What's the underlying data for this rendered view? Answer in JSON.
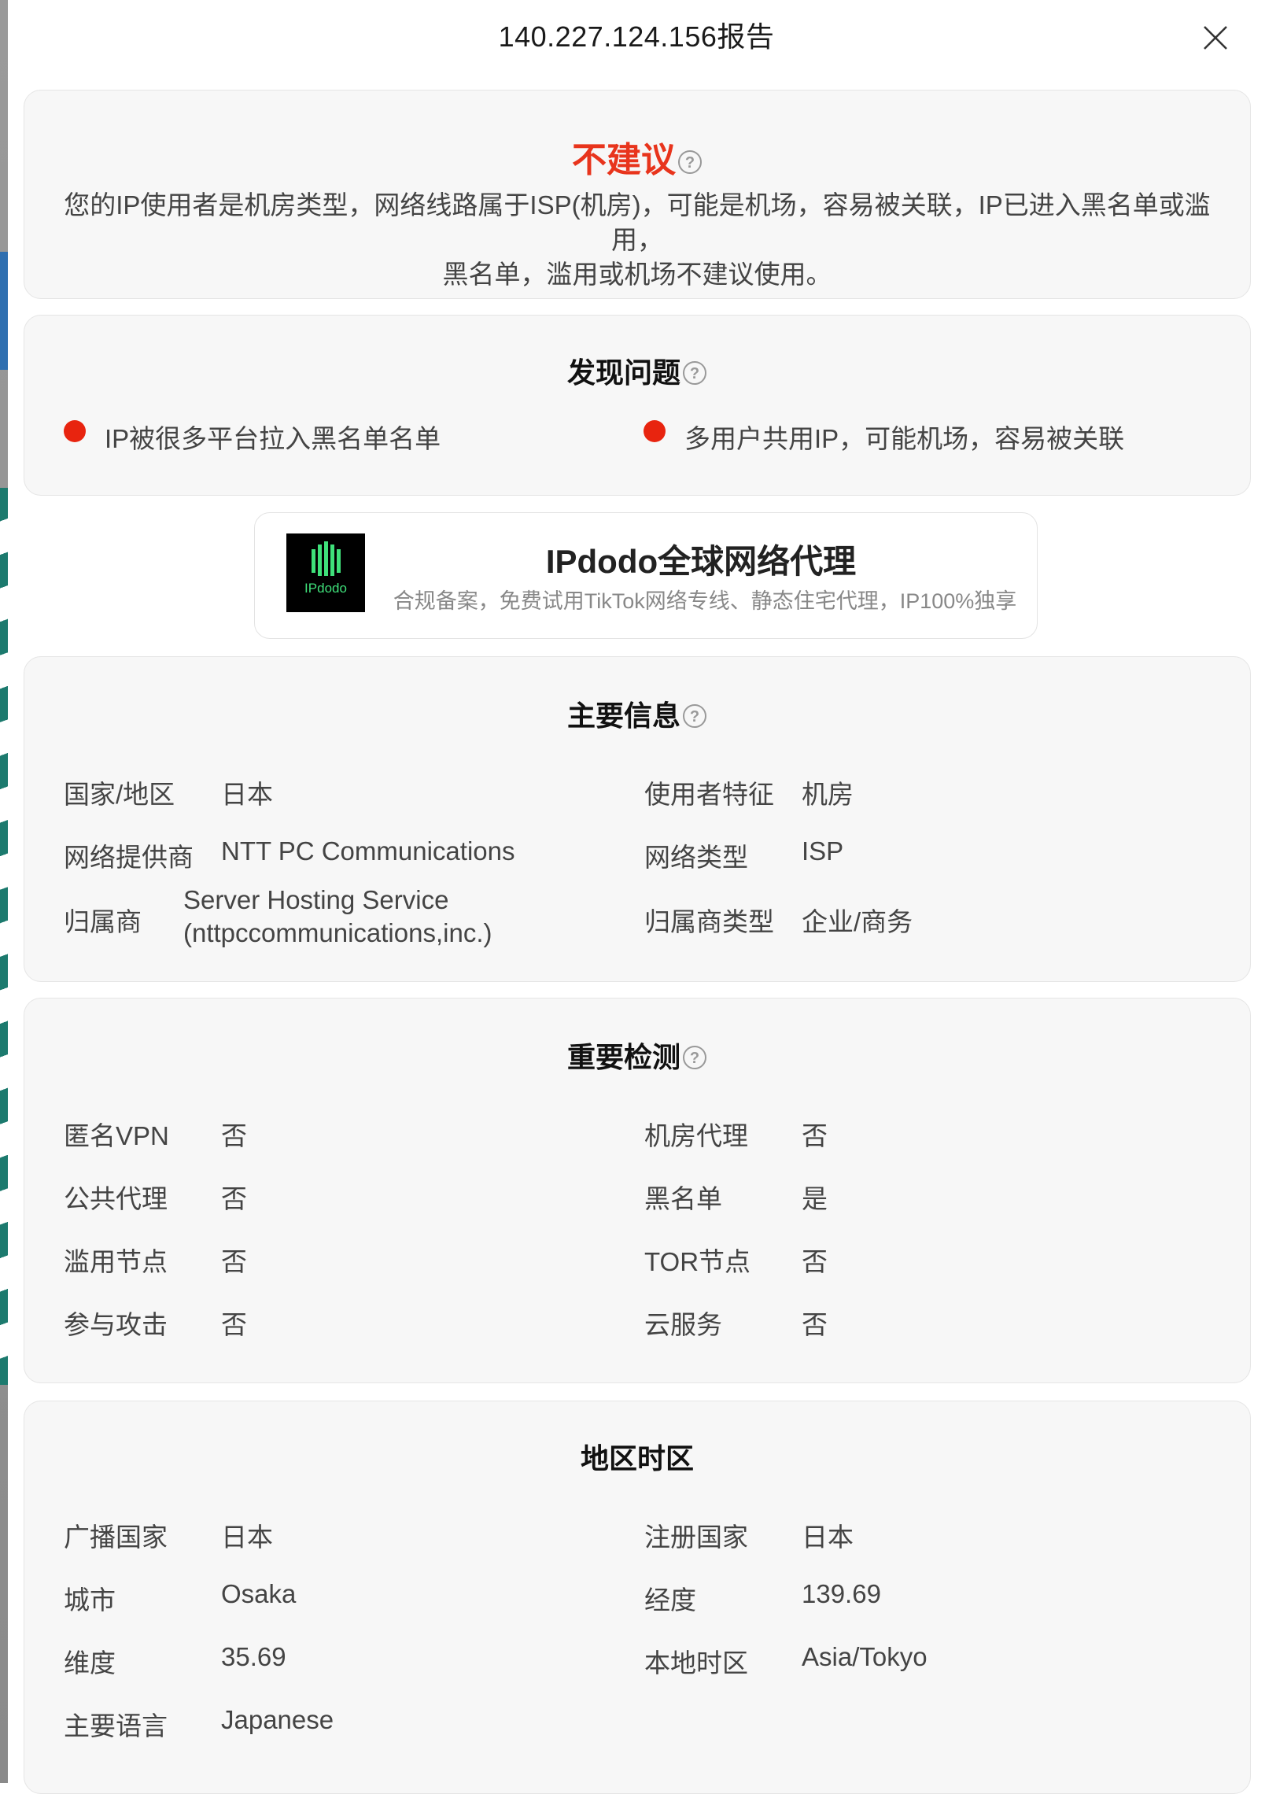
{
  "dialog": {
    "title": "140.227.124.156报告",
    "close_icon": "close-icon"
  },
  "verdict": {
    "title": "不建议",
    "color": "#e8341c",
    "description_line1": "您的IP使用者是机房类型，网络线路属于ISP(机房)，可能是机场，容易被关联，IP已进入黑名单或滥用，",
    "description_line2": "黑名单，滥用或机场不建议使用。"
  },
  "issues": {
    "title": "发现问题",
    "items": [
      {
        "label": "IP被很多平台拉入黑名单名单",
        "status_color": "#e8240f"
      },
      {
        "label": "多用户共用IP，可能机场，容易被关联",
        "status_color": "#e8240f"
      }
    ]
  },
  "ad": {
    "logo_text": "IPdodo",
    "title": "IPdodo全球网络代理",
    "subtitle": "合规备案，免费试用TikTok网络专线、静态住宅代理，IP100%独享"
  },
  "main_info": {
    "title": "主要信息",
    "rows": [
      {
        "label": "国家/地区",
        "value": "日本"
      },
      {
        "label": "使用者特征",
        "value": "机房"
      },
      {
        "label": "网络提供商",
        "value": "NTT PC Communications"
      },
      {
        "label": "网络类型",
        "value": "ISP"
      },
      {
        "label": "归属商",
        "value_line1": "Server Hosting Service",
        "value_line2": "(nttpccommunications,inc.)"
      },
      {
        "label": "归属商类型",
        "value": "企业/商务"
      }
    ]
  },
  "detection": {
    "title": "重要检测",
    "rows": [
      {
        "label": "匿名VPN",
        "value": "否"
      },
      {
        "label": "机房代理",
        "value": "否"
      },
      {
        "label": "公共代理",
        "value": "否"
      },
      {
        "label": "黑名单",
        "value": "是"
      },
      {
        "label": "滥用节点",
        "value": "否"
      },
      {
        "label": "TOR节点",
        "value": "否"
      },
      {
        "label": "参与攻击",
        "value": "否"
      },
      {
        "label": "云服务",
        "value": "否"
      }
    ]
  },
  "region": {
    "title": "地区时区",
    "rows": [
      {
        "label": "广播国家",
        "value": "日本"
      },
      {
        "label": "注册国家",
        "value": "日本"
      },
      {
        "label": "城市",
        "value": "Osaka"
      },
      {
        "label": "经度",
        "value": "139.69"
      },
      {
        "label": "维度",
        "value": "35.69"
      },
      {
        "label": "本地时区",
        "value": "Asia/Tokyo"
      },
      {
        "label": "主要语言",
        "value": "Japanese"
      }
    ]
  }
}
